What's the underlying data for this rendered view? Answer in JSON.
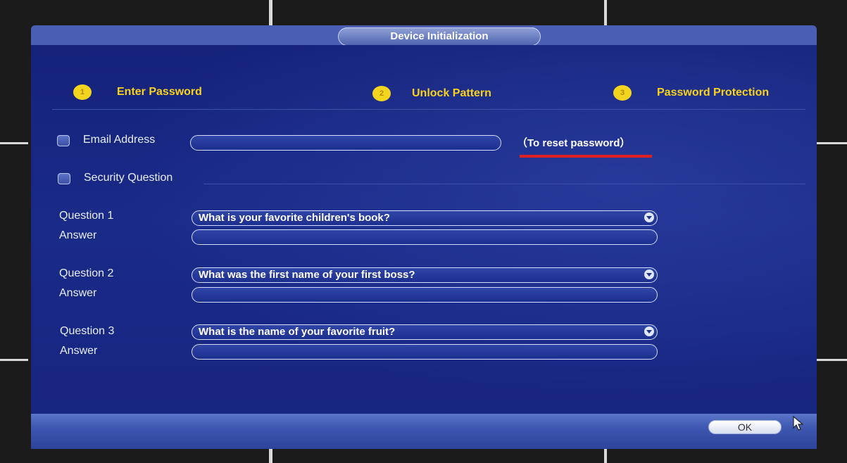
{
  "dialog": {
    "title": "Device Initialization"
  },
  "steps": [
    {
      "number": "1",
      "label": "Enter Password"
    },
    {
      "number": "2",
      "label": "Unlock Pattern"
    },
    {
      "number": "3",
      "label": "Password Protection"
    }
  ],
  "email": {
    "label": "Email Address",
    "value": "",
    "hint": "（To reset password）"
  },
  "security": {
    "label": "Security Question",
    "questions": [
      {
        "label": "Question 1",
        "selected": "What is your favorite children's book?",
        "answer_label": "Answer",
        "answer": ""
      },
      {
        "label": "Question 2",
        "selected": "What was the first name of your first boss?",
        "answer_label": "Answer",
        "answer": ""
      },
      {
        "label": "Question 3",
        "selected": "What is the name of your favorite fruit?",
        "answer_label": "Answer",
        "answer": ""
      }
    ]
  },
  "footer": {
    "ok_label": "OK"
  },
  "colors": {
    "step_accent": "#f8d21c",
    "dialog_bg": "#17257f",
    "hint_underline": "#e02020"
  }
}
